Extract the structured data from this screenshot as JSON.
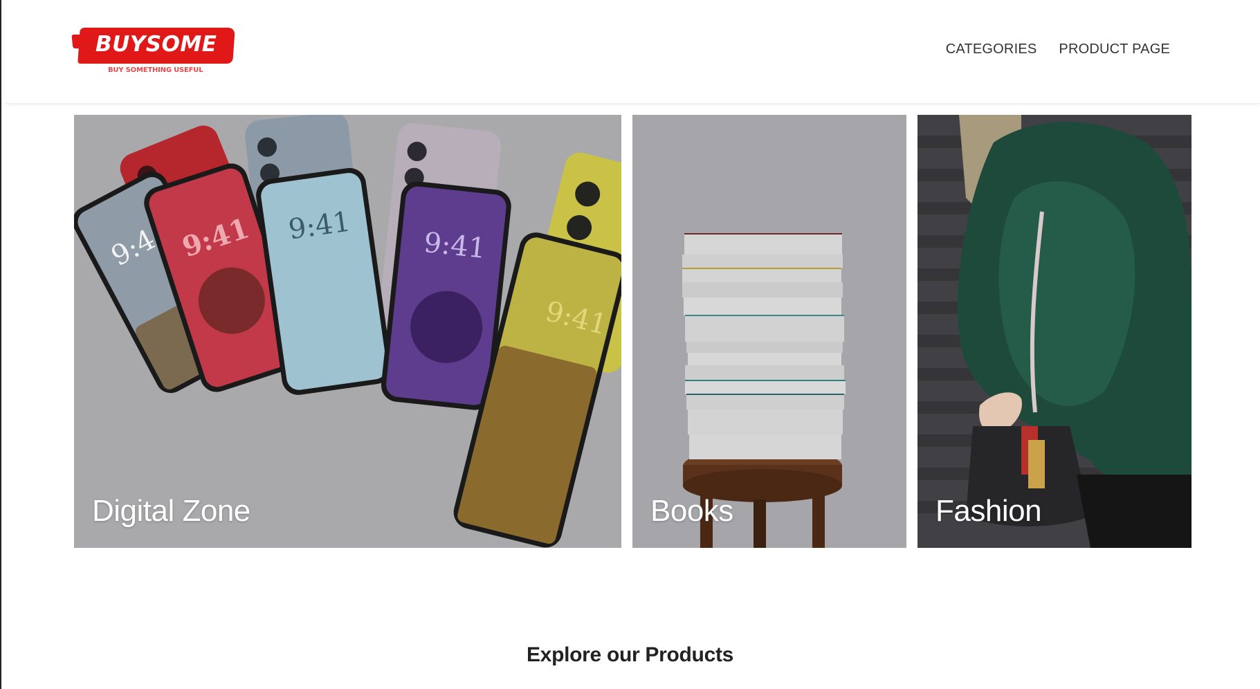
{
  "header": {
    "logo": {
      "name": "BUYSOME",
      "tagline": "BUY SOMETHING USEFUL",
      "brand_color": "#e01818"
    },
    "nav": [
      {
        "label": "CATEGORIES"
      },
      {
        "label": "PRODUCT PAGE"
      }
    ]
  },
  "categories": [
    {
      "title": "Digital Zone",
      "image": "smartphones-fan"
    },
    {
      "title": "Books",
      "image": "book-stack-on-stool"
    },
    {
      "title": "Fashion",
      "image": "green-fur-coat-with-bag"
    }
  ],
  "phone_screens": [
    {
      "time": "9:41"
    },
    {
      "time": "9:41"
    },
    {
      "time": "9:41"
    },
    {
      "time": "9:41"
    },
    {
      "time": "9:41"
    }
  ],
  "section": {
    "title": "Explore our Products"
  }
}
